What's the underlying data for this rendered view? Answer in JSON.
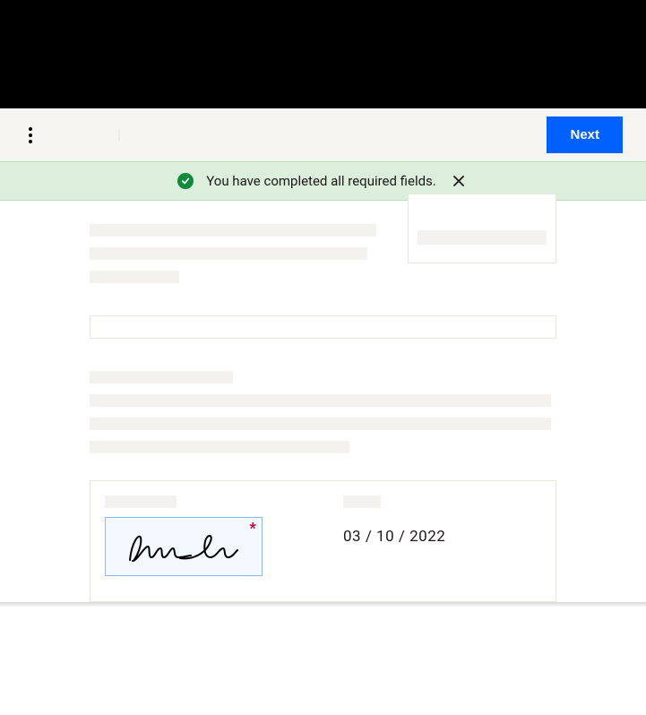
{
  "toolbar": {
    "next_label": "Next"
  },
  "banner": {
    "message": "You have completed all required fields."
  },
  "signature": {
    "required_marker": "*"
  },
  "date": {
    "value": "03 / 10 / 2022"
  }
}
